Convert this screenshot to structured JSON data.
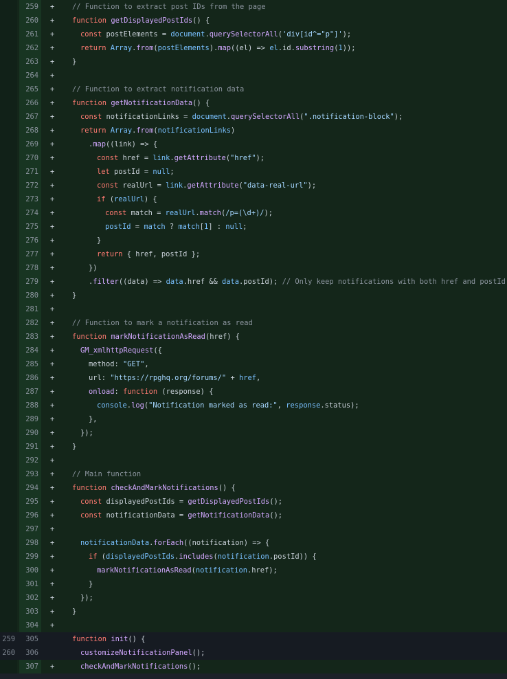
{
  "lines": [
    {
      "old": "",
      "new": "259",
      "sign": "+",
      "type": "add",
      "indent": 0,
      "tokens": [
        [
          "c",
          "// Function to extract post IDs from the page"
        ]
      ]
    },
    {
      "old": "",
      "new": "260",
      "sign": "+",
      "type": "add",
      "indent": 0,
      "tokens": [
        [
          "k",
          "function "
        ],
        [
          "f",
          "getDisplayedPostIds"
        ],
        [
          "p",
          "() {"
        ]
      ]
    },
    {
      "old": "",
      "new": "261",
      "sign": "+",
      "type": "add",
      "indent": 1,
      "tokens": [
        [
          "k",
          "const "
        ],
        [
          "p",
          "postElements = "
        ],
        [
          "v",
          "document"
        ],
        [
          "p",
          "."
        ],
        [
          "f",
          "querySelectorAll"
        ],
        [
          "p",
          "("
        ],
        [
          "s",
          "'div[id^=\"p\"]'"
        ],
        [
          "p",
          ");"
        ]
      ]
    },
    {
      "old": "",
      "new": "262",
      "sign": "+",
      "type": "add",
      "indent": 1,
      "tokens": [
        [
          "k",
          "return "
        ],
        [
          "v",
          "Array"
        ],
        [
          "p",
          "."
        ],
        [
          "f",
          "from"
        ],
        [
          "p",
          "("
        ],
        [
          "v",
          "postElements"
        ],
        [
          "p",
          ")."
        ],
        [
          "f",
          "map"
        ],
        [
          "p",
          "((el) => "
        ],
        [
          "v",
          "el"
        ],
        [
          "p",
          ".id."
        ],
        [
          "f",
          "substring"
        ],
        [
          "p",
          "("
        ],
        [
          "v",
          "1"
        ],
        [
          "p",
          "));"
        ]
      ]
    },
    {
      "old": "",
      "new": "263",
      "sign": "+",
      "type": "add",
      "indent": 0,
      "tokens": [
        [
          "p",
          "}"
        ]
      ]
    },
    {
      "old": "",
      "new": "264",
      "sign": "+",
      "type": "add",
      "indent": 0,
      "tokens": []
    },
    {
      "old": "",
      "new": "265",
      "sign": "+",
      "type": "add",
      "indent": 0,
      "tokens": [
        [
          "c",
          "// Function to extract notification data"
        ]
      ]
    },
    {
      "old": "",
      "new": "266",
      "sign": "+",
      "type": "add",
      "indent": 0,
      "tokens": [
        [
          "k",
          "function "
        ],
        [
          "f",
          "getNotificationData"
        ],
        [
          "p",
          "() {"
        ]
      ]
    },
    {
      "old": "",
      "new": "267",
      "sign": "+",
      "type": "add",
      "indent": 1,
      "tokens": [
        [
          "k",
          "const "
        ],
        [
          "p",
          "notificationLinks = "
        ],
        [
          "v",
          "document"
        ],
        [
          "p",
          "."
        ],
        [
          "f",
          "querySelectorAll"
        ],
        [
          "p",
          "("
        ],
        [
          "s",
          "\".notification-block\""
        ],
        [
          "p",
          ");"
        ]
      ]
    },
    {
      "old": "",
      "new": "268",
      "sign": "+",
      "type": "add",
      "indent": 1,
      "tokens": [
        [
          "k",
          "return "
        ],
        [
          "v",
          "Array"
        ],
        [
          "p",
          "."
        ],
        [
          "f",
          "from"
        ],
        [
          "p",
          "("
        ],
        [
          "v",
          "notificationLinks"
        ],
        [
          "p",
          ")"
        ]
      ]
    },
    {
      "old": "",
      "new": "269",
      "sign": "+",
      "type": "add",
      "indent": 2,
      "tokens": [
        [
          "p",
          "."
        ],
        [
          "f",
          "map"
        ],
        [
          "p",
          "((link) => {"
        ]
      ]
    },
    {
      "old": "",
      "new": "270",
      "sign": "+",
      "type": "add",
      "indent": 3,
      "tokens": [
        [
          "k",
          "const "
        ],
        [
          "p",
          "href = "
        ],
        [
          "v",
          "link"
        ],
        [
          "p",
          "."
        ],
        [
          "f",
          "getAttribute"
        ],
        [
          "p",
          "("
        ],
        [
          "s",
          "\"href\""
        ],
        [
          "p",
          ");"
        ]
      ]
    },
    {
      "old": "",
      "new": "271",
      "sign": "+",
      "type": "add",
      "indent": 3,
      "tokens": [
        [
          "k",
          "let "
        ],
        [
          "p",
          "postId = "
        ],
        [
          "v",
          "null"
        ],
        [
          "p",
          ";"
        ]
      ]
    },
    {
      "old": "",
      "new": "272",
      "sign": "+",
      "type": "add",
      "indent": 3,
      "tokens": [
        [
          "k",
          "const "
        ],
        [
          "p",
          "realUrl = "
        ],
        [
          "v",
          "link"
        ],
        [
          "p",
          "."
        ],
        [
          "f",
          "getAttribute"
        ],
        [
          "p",
          "("
        ],
        [
          "s",
          "\"data-real-url\""
        ],
        [
          "p",
          ");"
        ]
      ]
    },
    {
      "old": "",
      "new": "273",
      "sign": "+",
      "type": "add",
      "indent": 3,
      "tokens": [
        [
          "k",
          "if "
        ],
        [
          "p",
          "("
        ],
        [
          "v",
          "realUrl"
        ],
        [
          "p",
          ") {"
        ]
      ]
    },
    {
      "old": "",
      "new": "274",
      "sign": "+",
      "type": "add",
      "indent": 4,
      "tokens": [
        [
          "k",
          "const "
        ],
        [
          "p",
          "match = "
        ],
        [
          "v",
          "realUrl"
        ],
        [
          "p",
          "."
        ],
        [
          "f",
          "match"
        ],
        [
          "p",
          "("
        ],
        [
          "s",
          "/p=(\\d+)/"
        ],
        [
          "p",
          ");"
        ]
      ]
    },
    {
      "old": "",
      "new": "275",
      "sign": "+",
      "type": "add",
      "indent": 4,
      "tokens": [
        [
          "v",
          "postId"
        ],
        [
          "p",
          " = "
        ],
        [
          "v",
          "match"
        ],
        [
          "p",
          " ? "
        ],
        [
          "v",
          "match"
        ],
        [
          "p",
          "["
        ],
        [
          "v",
          "1"
        ],
        [
          "p",
          "] : "
        ],
        [
          "v",
          "null"
        ],
        [
          "p",
          ";"
        ]
      ]
    },
    {
      "old": "",
      "new": "276",
      "sign": "+",
      "type": "add",
      "indent": 3,
      "tokens": [
        [
          "p",
          "}"
        ]
      ]
    },
    {
      "old": "",
      "new": "277",
      "sign": "+",
      "type": "add",
      "indent": 3,
      "tokens": [
        [
          "k",
          "return "
        ],
        [
          "p",
          "{ href, postId };"
        ]
      ]
    },
    {
      "old": "",
      "new": "278",
      "sign": "+",
      "type": "add",
      "indent": 2,
      "tokens": [
        [
          "p",
          "})"
        ]
      ]
    },
    {
      "old": "",
      "new": "279",
      "sign": "+",
      "type": "add",
      "indent": 2,
      "tokens": [
        [
          "p",
          "."
        ],
        [
          "f",
          "filter"
        ],
        [
          "p",
          "((data) => "
        ],
        [
          "v",
          "data"
        ],
        [
          "p",
          ".href && "
        ],
        [
          "v",
          "data"
        ],
        [
          "p",
          ".postId); "
        ],
        [
          "c",
          "// Only keep notifications with both href and postId"
        ]
      ]
    },
    {
      "old": "",
      "new": "280",
      "sign": "+",
      "type": "add",
      "indent": 0,
      "tokens": [
        [
          "p",
          "}"
        ]
      ]
    },
    {
      "old": "",
      "new": "281",
      "sign": "+",
      "type": "add",
      "indent": 0,
      "tokens": []
    },
    {
      "old": "",
      "new": "282",
      "sign": "+",
      "type": "add",
      "indent": 0,
      "tokens": [
        [
          "c",
          "// Function to mark a notification as read"
        ]
      ]
    },
    {
      "old": "",
      "new": "283",
      "sign": "+",
      "type": "add",
      "indent": 0,
      "tokens": [
        [
          "k",
          "function "
        ],
        [
          "f",
          "markNotificationAsRead"
        ],
        [
          "p",
          "(href) {"
        ]
      ]
    },
    {
      "old": "",
      "new": "284",
      "sign": "+",
      "type": "add",
      "indent": 1,
      "tokens": [
        [
          "f",
          "GM_xmlhttpRequest"
        ],
        [
          "p",
          "({"
        ]
      ]
    },
    {
      "old": "",
      "new": "285",
      "sign": "+",
      "type": "add",
      "indent": 2,
      "tokens": [
        [
          "p",
          "method: "
        ],
        [
          "s",
          "\"GET\""
        ],
        [
          "p",
          ","
        ]
      ]
    },
    {
      "old": "",
      "new": "286",
      "sign": "+",
      "type": "add",
      "indent": 2,
      "tokens": [
        [
          "p",
          "url: "
        ],
        [
          "s",
          "\"https://rpghq.org/forums/\""
        ],
        [
          "p",
          " + "
        ],
        [
          "v",
          "href"
        ],
        [
          "p",
          ","
        ]
      ]
    },
    {
      "old": "",
      "new": "287",
      "sign": "+",
      "type": "add",
      "indent": 2,
      "tokens": [
        [
          "f",
          "onload"
        ],
        [
          "p",
          ": "
        ],
        [
          "k",
          "function "
        ],
        [
          "p",
          "(response) {"
        ]
      ]
    },
    {
      "old": "",
      "new": "288",
      "sign": "+",
      "type": "add",
      "indent": 3,
      "tokens": [
        [
          "v",
          "console"
        ],
        [
          "p",
          "."
        ],
        [
          "f",
          "log"
        ],
        [
          "p",
          "("
        ],
        [
          "s",
          "\"Notification marked as read:\""
        ],
        [
          "p",
          ", "
        ],
        [
          "v",
          "response"
        ],
        [
          "p",
          ".status);"
        ]
      ]
    },
    {
      "old": "",
      "new": "289",
      "sign": "+",
      "type": "add",
      "indent": 2,
      "tokens": [
        [
          "p",
          "},"
        ]
      ]
    },
    {
      "old": "",
      "new": "290",
      "sign": "+",
      "type": "add",
      "indent": 1,
      "tokens": [
        [
          "p",
          "});"
        ]
      ]
    },
    {
      "old": "",
      "new": "291",
      "sign": "+",
      "type": "add",
      "indent": 0,
      "tokens": [
        [
          "p",
          "}"
        ]
      ]
    },
    {
      "old": "",
      "new": "292",
      "sign": "+",
      "type": "add",
      "indent": 0,
      "tokens": []
    },
    {
      "old": "",
      "new": "293",
      "sign": "+",
      "type": "add",
      "indent": 0,
      "tokens": [
        [
          "c",
          "// Main function"
        ]
      ]
    },
    {
      "old": "",
      "new": "294",
      "sign": "+",
      "type": "add",
      "indent": 0,
      "tokens": [
        [
          "k",
          "function "
        ],
        [
          "f",
          "checkAndMarkNotifications"
        ],
        [
          "p",
          "() {"
        ]
      ]
    },
    {
      "old": "",
      "new": "295",
      "sign": "+",
      "type": "add",
      "indent": 1,
      "tokens": [
        [
          "k",
          "const "
        ],
        [
          "p",
          "displayedPostIds = "
        ],
        [
          "f",
          "getDisplayedPostIds"
        ],
        [
          "p",
          "();"
        ]
      ]
    },
    {
      "old": "",
      "new": "296",
      "sign": "+",
      "type": "add",
      "indent": 1,
      "tokens": [
        [
          "k",
          "const "
        ],
        [
          "p",
          "notificationData = "
        ],
        [
          "f",
          "getNotificationData"
        ],
        [
          "p",
          "();"
        ]
      ]
    },
    {
      "old": "",
      "new": "297",
      "sign": "+",
      "type": "add",
      "indent": 0,
      "tokens": []
    },
    {
      "old": "",
      "new": "298",
      "sign": "+",
      "type": "add",
      "indent": 1,
      "tokens": [
        [
          "v",
          "notificationData"
        ],
        [
          "p",
          "."
        ],
        [
          "f",
          "forEach"
        ],
        [
          "p",
          "((notification) => {"
        ]
      ]
    },
    {
      "old": "",
      "new": "299",
      "sign": "+",
      "type": "add",
      "indent": 2,
      "tokens": [
        [
          "k",
          "if "
        ],
        [
          "p",
          "("
        ],
        [
          "v",
          "displayedPostIds"
        ],
        [
          "p",
          "."
        ],
        [
          "f",
          "includes"
        ],
        [
          "p",
          "("
        ],
        [
          "v",
          "notification"
        ],
        [
          "p",
          ".postId)) {"
        ]
      ]
    },
    {
      "old": "",
      "new": "300",
      "sign": "+",
      "type": "add",
      "indent": 3,
      "tokens": [
        [
          "f",
          "markNotificationAsRead"
        ],
        [
          "p",
          "("
        ],
        [
          "v",
          "notification"
        ],
        [
          "p",
          ".href);"
        ]
      ]
    },
    {
      "old": "",
      "new": "301",
      "sign": "+",
      "type": "add",
      "indent": 2,
      "tokens": [
        [
          "p",
          "}"
        ]
      ]
    },
    {
      "old": "",
      "new": "302",
      "sign": "+",
      "type": "add",
      "indent": 1,
      "tokens": [
        [
          "p",
          "});"
        ]
      ]
    },
    {
      "old": "",
      "new": "303",
      "sign": "+",
      "type": "add",
      "indent": 0,
      "tokens": [
        [
          "p",
          "}"
        ]
      ]
    },
    {
      "old": "",
      "new": "304",
      "sign": "+",
      "type": "add",
      "indent": 0,
      "tokens": []
    },
    {
      "old": "259",
      "new": "305",
      "sign": "",
      "type": "ctx",
      "indent": 0,
      "tokens": [
        [
          "k",
          "function "
        ],
        [
          "f",
          "init"
        ],
        [
          "p",
          "() {"
        ]
      ]
    },
    {
      "old": "260",
      "new": "306",
      "sign": "",
      "type": "ctx",
      "indent": 1,
      "tokens": [
        [
          "f",
          "customizeNotificationPanel"
        ],
        [
          "p",
          "();"
        ]
      ]
    },
    {
      "old": "",
      "new": "307",
      "sign": "+",
      "type": "add",
      "indent": 1,
      "tokens": [
        [
          "f",
          "checkAndMarkNotifications"
        ],
        [
          "p",
          "();"
        ]
      ]
    }
  ]
}
